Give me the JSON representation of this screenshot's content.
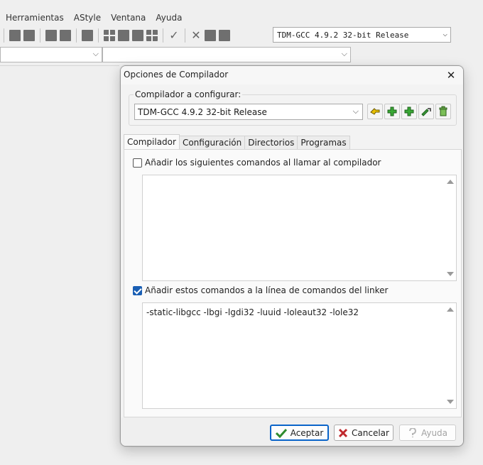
{
  "menu": [
    "Herramientas",
    "AStyle",
    "Ventana",
    "Ayuda"
  ],
  "toolbar": {
    "compiler_select": "TDM-GCC 4.9.2 32-bit Release"
  },
  "dialog": {
    "title": "Opciones de Compilador",
    "group_label": "Compilador a configurar:",
    "compiler_value": "TDM-GCC 4.9.2 32-bit Release",
    "tabs": [
      "Compilador",
      "Configuración",
      "Directorios",
      "Programas"
    ],
    "compiler_check_label": "Añadir los siguientes comandos al llamar al compilador",
    "compiler_check_checked": false,
    "compiler_commands": "",
    "linker_check_label": "Añadir estos comandos a la línea de comandos del linker",
    "linker_check_checked": true,
    "linker_commands": "-static-libgcc -lbgi -lgdi32 -luuid -loleaut32 -lole32",
    "buttons": {
      "ok": "Aceptar",
      "cancel": "Cancelar",
      "help": "Ayuda"
    }
  },
  "colors": {
    "accent": "#0a64c9",
    "check": "#1a5fb4",
    "ok_icon": "#2e8b2e",
    "cancel_icon": "#c0282d"
  }
}
